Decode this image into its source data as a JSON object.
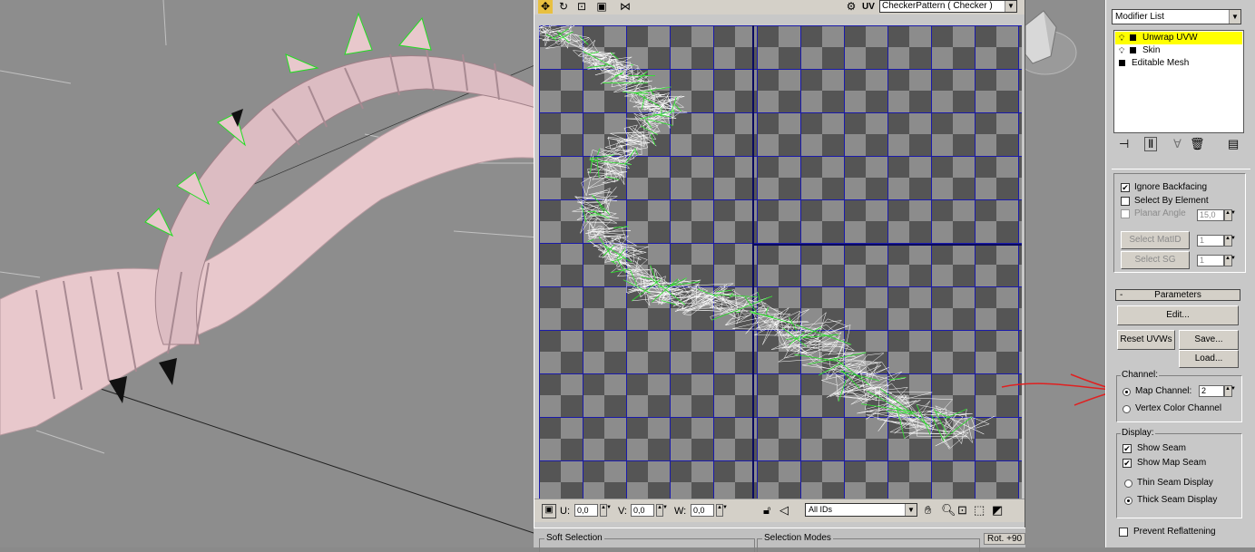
{
  "uv_editor": {
    "texture_select": "CheckerPattern  ( Checker )",
    "uv_label": "UV",
    "u_label": "U:",
    "u_value": "0,0",
    "v_label": "V:",
    "v_value": "0,0",
    "w_label": "W:",
    "w_value": "0,0",
    "ids_select": "All IDs"
  },
  "below_editor": {
    "soft_selection": "Soft Selection",
    "selection_modes": "Selection Modes",
    "rot_label": "Rot. +90"
  },
  "modifier_panel": {
    "modifier_list": "Modifier List",
    "stack": [
      {
        "label": "Unwrap UVW",
        "selected": true
      },
      {
        "label": "Skin",
        "selected": false
      },
      {
        "label": "Editable Mesh",
        "selected": false
      }
    ]
  },
  "rollout": {
    "ignore_backfacing": "Ignore Backfacing",
    "select_by_element": "Select By Element",
    "planar_angle": "Planar Angle",
    "planar_angle_value": "15,0",
    "select_matid": "Select MatID",
    "matid_value": "1",
    "select_sg": "Select SG",
    "sg_value": "1",
    "parameters_title": "Parameters",
    "parameters_minus": "-",
    "edit": "Edit...",
    "reset_uvws": "Reset UVWs",
    "save": "Save...",
    "load": "Load...",
    "channel_title": "Channel:",
    "map_channel": "Map Channel:",
    "map_channel_value": "2",
    "vertex_color_channel": "Vertex Color Channel",
    "display_title": "Display:",
    "show_seam": "Show Seam",
    "show_map_seam": "Show Map Seam",
    "thin_seam_display": "Thin Seam Display",
    "thick_seam_display": "Thick Seam Display",
    "prevent_reflattening": "Prevent Reflattening"
  },
  "colors": {
    "selected_modifier": "#ffff00",
    "uv_grid_line": "#1a1aaa",
    "uv_wire": "#ffffff",
    "uv_seam": "#22dd22",
    "annotation_arrow": "#e02020"
  }
}
